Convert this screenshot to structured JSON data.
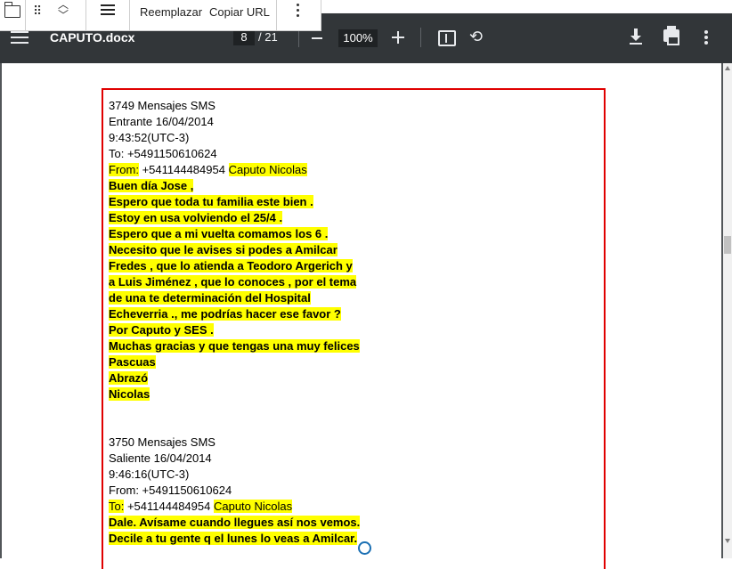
{
  "floating_toolbar": {
    "replace_label": "Reemplazar",
    "copy_url_label": "Copiar URL"
  },
  "viewer": {
    "file_name": "CAPUTO.docx",
    "current_page": "8",
    "total_pages": "/ 21",
    "zoom": "100%"
  },
  "document": {
    "messages": [
      {
        "header": "3749 Mensajes SMS",
        "direction": "Entrante 16/04/2014",
        "time": "9:43:52(UTC-3)",
        "to": "To: +5491150610624",
        "from_label": "From:",
        "from_number": " +541144484954 ",
        "from_name": "Caputo Nicolas",
        "body": [
          "Buen día Jose ,",
          "Espero que toda tu familia este bien .",
          "Estoy en usa volviendo el 25/4 .",
          "Espero que a mi vuelta comamos los 6 .",
          "Necesito que le avises si podes a Amilcar",
          "Fredes , que lo atienda a Teodoro Argerich y",
          "a Luis Jiménez , que lo conoces , por el tema",
          "de una te determinación del Hospital",
          "Echeverria ., me podrías hacer ese favor ?",
          "Por Caputo y SES .",
          "Muchas gracias y que tengas una muy felices",
          "Pascuas",
          "Abrazó",
          "Nicolas"
        ]
      },
      {
        "header": "3750 Mensajes SMS",
        "direction": "Saliente 16/04/2014",
        "time": "9:46:16(UTC-3)",
        "from": "From: +5491150610624",
        "to_label": "To:",
        "to_number": " +541144484954 ",
        "to_name": "Caputo Nicolas",
        "body": [
          "Dale. Avísame cuando llegues así nos vemos.",
          "Decile a tu gente q el lunes lo veas a Amilcar."
        ]
      }
    ]
  }
}
